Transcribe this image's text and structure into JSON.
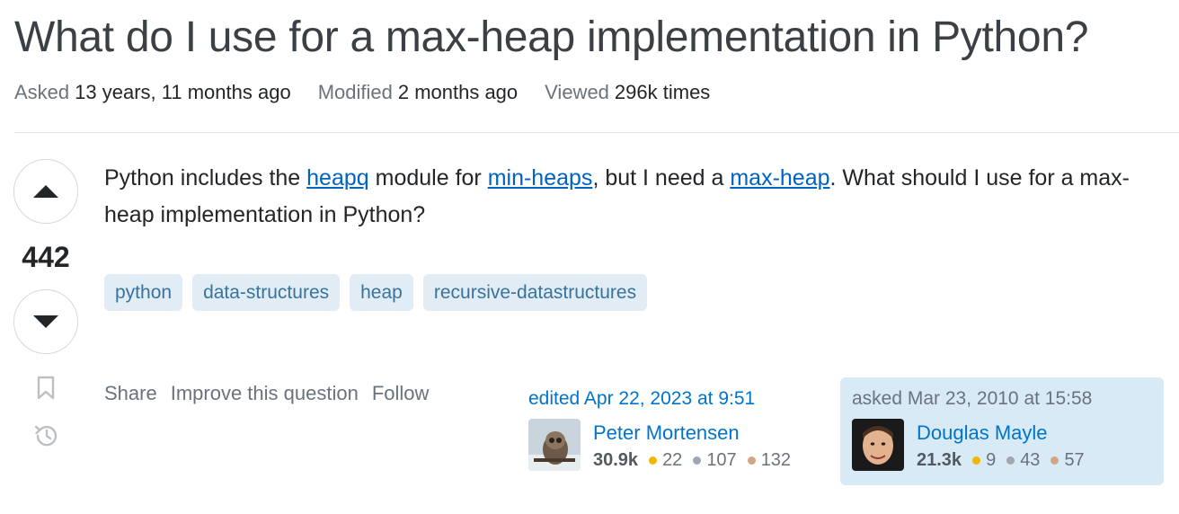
{
  "question": {
    "title": "What do I use for a max-heap implementation in Python?",
    "meta": {
      "asked_label": "Asked",
      "asked_value": "13 years, 11 months ago",
      "modified_label": "Modified",
      "modified_value": "2 months ago",
      "viewed_label": "Viewed",
      "viewed_value": "296k times"
    },
    "votes": "442",
    "body": {
      "t1": "Python includes the ",
      "l1": "heapq",
      "t2": " module for ",
      "l2": "min-heaps",
      "t3": ", but I need a ",
      "l3": "max-heap",
      "t4": ". What should I use for a max-heap implementation in Python?"
    },
    "tags": [
      "python",
      "data-structures",
      "heap",
      "recursive-datastructures"
    ],
    "actions": {
      "share": "Share",
      "improve": "Improve this question",
      "follow": "Follow"
    }
  },
  "editor": {
    "action": "edited Apr 22, 2023 at 9:51",
    "name": "Peter Mortensen",
    "reputation": "30.9k",
    "gold": "22",
    "silver": "107",
    "bronze": "132"
  },
  "asker": {
    "action": "asked Mar 23, 2010 at 15:58",
    "name": "Douglas Mayle",
    "reputation": "21.3k",
    "gold": "9",
    "silver": "43",
    "bronze": "57"
  },
  "colors": {
    "link": "#0063bf",
    "tag_bg": "#e1ecf4",
    "tag_text": "#39739d",
    "gold": "#f1b600",
    "silver": "#9fa6ad",
    "bronze": "#d1a684"
  },
  "icons": {
    "upvote": "triangle-up-icon",
    "downvote": "triangle-down-icon",
    "bookmark": "bookmark-icon",
    "history": "history-icon"
  }
}
